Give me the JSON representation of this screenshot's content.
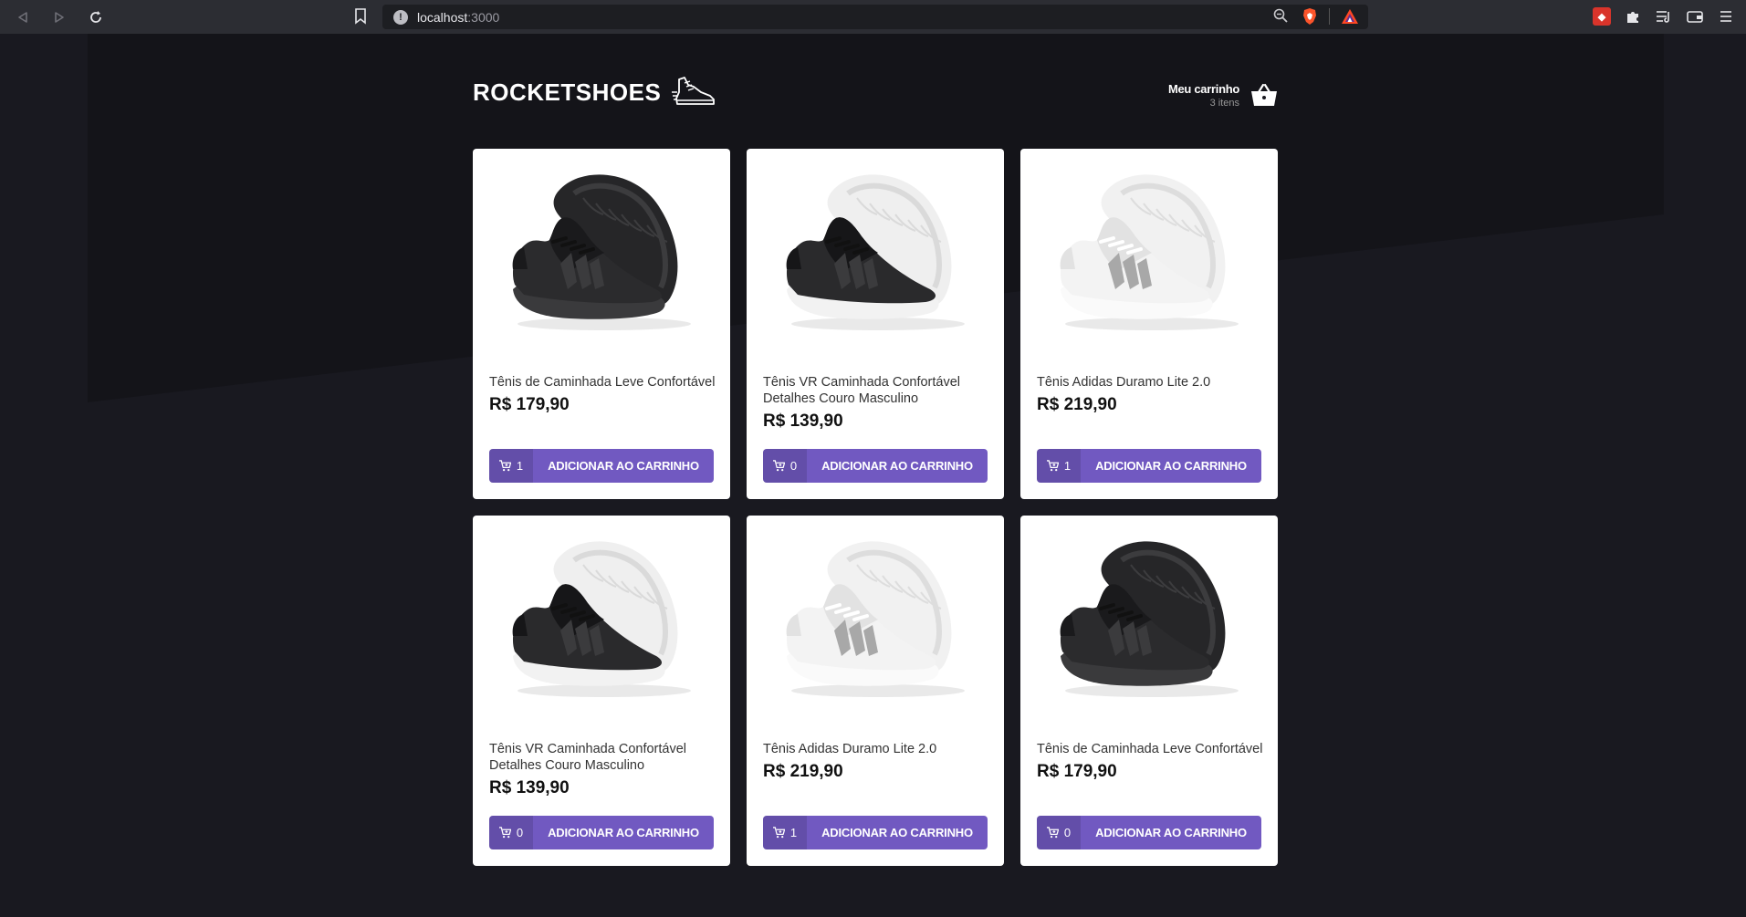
{
  "browser": {
    "url_host": "localhost",
    "url_port": ":3000"
  },
  "header": {
    "logo_text": "ROCKETSHOES",
    "cart_title": "Meu carrinho",
    "cart_count": "3 itens"
  },
  "products": [
    {
      "title": "Tênis de Caminhada Leve Confortável",
      "price": "R$ 179,90",
      "amount": "1",
      "button_label": "ADICIONAR AO CARRINHO",
      "variant": "all-black"
    },
    {
      "title": "Tênis VR Caminhada Confortável Detalhes Couro Masculino",
      "price": "R$ 139,90",
      "amount": "0",
      "button_label": "ADICIONAR AO CARRINHO",
      "variant": "black-white"
    },
    {
      "title": "Tênis Adidas Duramo Lite 2.0",
      "price": "R$ 219,90",
      "amount": "1",
      "button_label": "ADICIONAR AO CARRINHO",
      "variant": "white-grey"
    },
    {
      "title": "Tênis VR Caminhada Confortável Detalhes Couro Masculino",
      "price": "R$ 139,90",
      "amount": "0",
      "button_label": "ADICIONAR AO CARRINHO",
      "variant": "black-white"
    },
    {
      "title": "Tênis Adidas Duramo Lite 2.0",
      "price": "R$ 219,90",
      "amount": "1",
      "button_label": "ADICIONAR AO CARRINHO",
      "variant": "white-grey"
    },
    {
      "title": "Tênis de Caminhada Leve Confortável",
      "price": "R$ 179,90",
      "amount": "0",
      "button_label": "ADICIONAR AO CARRINHO",
      "variant": "all-black"
    }
  ],
  "colors": {
    "accent": "#7159c1",
    "background": "#191920",
    "card": "#ffffff"
  }
}
